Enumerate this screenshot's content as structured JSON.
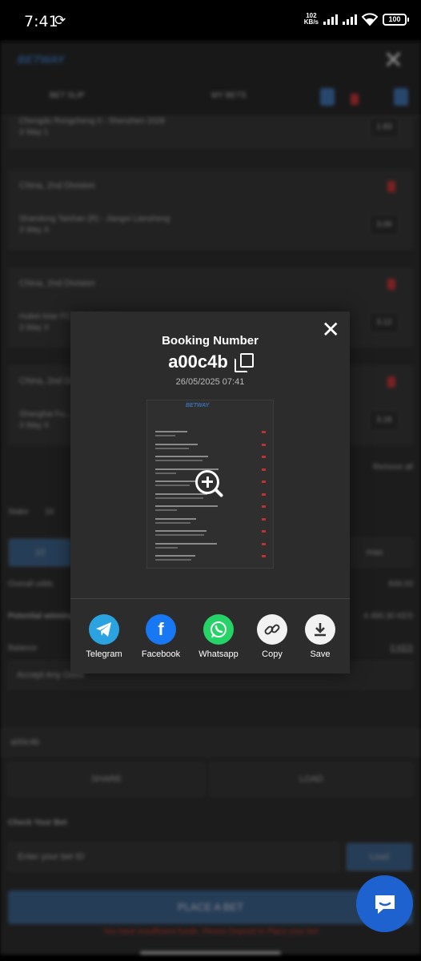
{
  "status_bar": {
    "time": "7:41",
    "net_speed": "102",
    "net_unit": "KB/s",
    "battery": "100",
    "icons": [
      "sync-icon",
      "signal-icon",
      "signal-icon",
      "wifi-icon",
      "battery-icon"
    ]
  },
  "background": {
    "logo": "BETWAY",
    "tabs": {
      "bet_slip": "BET SLIP",
      "my_bets": "MY BETS"
    },
    "bets": [
      {
        "league": "",
        "match": "Chengdu Rongcheng II - Shenzhen 2028",
        "market": "3 Way 1",
        "odds": "1.83"
      },
      {
        "league": "China, 2nd Division",
        "match": "Shandong Taishan (R) - Jiangxi Liansheng",
        "market": "3 Way X",
        "odds": "3.06"
      },
      {
        "league": "China, 2nd Division",
        "match": "Hubei Istar FC - Dalian Kun...",
        "market": "3 Way X",
        "odds": "3.12"
      },
      {
        "league": "China, 2nd Division",
        "match": "Shanghai Fu...",
        "market": "3 Way X",
        "odds": "3.18"
      }
    ],
    "remove_all": "Remove all",
    "stake_label": "Stake",
    "stake_value": "10",
    "max_label": "max",
    "quick_stake": "10",
    "overall_odds_label": "Overall odds",
    "overall_odds_value": "849.03",
    "potential_win_label": "Potential winnings",
    "potential_win_value": "4 490.30 KES",
    "balance_label": "Balance",
    "balance_value": "0 KES",
    "accept_label": "Accept Any Odds",
    "booking_code_field": "a00c4b",
    "share_label": "SHARE",
    "load_label": "LOAD",
    "check_bet_title": "Check Your Bet",
    "bet_id_placeholder": "Enter your bet ID",
    "load_button": "Load",
    "place_bet": "PLACE A BET",
    "warning": "You have insufficient funds. Please Deposit to Place your bet"
  },
  "modal": {
    "title": "Booking Number",
    "code": "a00c4b",
    "datetime": "26/05/2025 07:41",
    "share_options": [
      {
        "label": "Telegram",
        "icon": "telegram-icon",
        "color": "#2AA3E0"
      },
      {
        "label": "Facebook",
        "icon": "facebook-icon",
        "color": "#1877F2"
      },
      {
        "label": "Whatsapp",
        "icon": "whatsapp-icon",
        "color": "#25D366"
      },
      {
        "label": "Copy",
        "icon": "link-icon",
        "color": "#F2F2F2"
      },
      {
        "label": "Save",
        "icon": "download-icon",
        "color": "#F2F2F2"
      }
    ]
  },
  "colors": {
    "accent": "#1E62D0",
    "modal_bg": "#2C2C2C"
  }
}
